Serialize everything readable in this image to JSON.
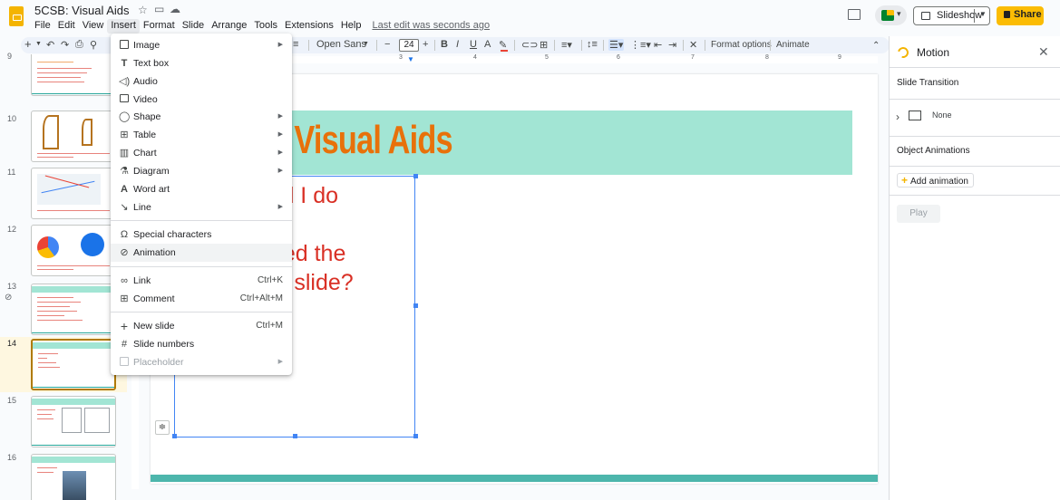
{
  "header": {
    "doc_title": "5CSB: Visual Aids",
    "menus": [
      "File",
      "Edit",
      "View",
      "Insert",
      "Format",
      "Slide",
      "Arrange",
      "Tools",
      "Extensions",
      "Help"
    ],
    "last_edit": "Last edit was seconds ago",
    "slideshow_label": "Slideshow",
    "share_label": "Share"
  },
  "toolbar": {
    "font_name": "Open Sans",
    "font_size": "24",
    "format_options": "Format options",
    "animate": "Animate",
    "ruler_marks": [
      "2",
      "3",
      "4",
      "5",
      "6",
      "7",
      "8",
      "9"
    ]
  },
  "insert_menu": {
    "items": [
      {
        "label": "Image",
        "icon": "image-icon",
        "submenu": true
      },
      {
        "label": "Text box",
        "icon": "text-box-icon"
      },
      {
        "label": "Audio",
        "icon": "audio-icon"
      },
      {
        "label": "Video",
        "icon": "video-icon"
      },
      {
        "label": "Shape",
        "icon": "shape-icon",
        "submenu": true
      },
      {
        "label": "Table",
        "icon": "table-icon",
        "submenu": true
      },
      {
        "label": "Chart",
        "icon": "chart-icon",
        "submenu": true
      },
      {
        "label": "Diagram",
        "icon": "diagram-icon",
        "submenu": true
      },
      {
        "label": "Word art",
        "icon": "word-art-icon"
      },
      {
        "label": "Line",
        "icon": "line-icon",
        "submenu": true
      },
      {
        "label": "Special characters",
        "icon": "omega-icon"
      },
      {
        "label": "Animation",
        "icon": "animation-icon"
      },
      {
        "label": "Link",
        "icon": "link-icon",
        "shortcut": "Ctrl+K"
      },
      {
        "label": "Comment",
        "icon": "comment-icon",
        "shortcut": "Ctrl+Alt+M"
      },
      {
        "label": "New slide",
        "icon": "plus-icon",
        "shortcut": "Ctrl+M"
      },
      {
        "label": "Slide numbers",
        "icon": "hash-icon"
      },
      {
        "label": "Placeholder",
        "icon": "placeholder-icon",
        "submenu": true,
        "disabled": true
      }
    ]
  },
  "filmstrip": {
    "slide_numbers": [
      "9",
      "10",
      "11",
      "12",
      "13",
      "14",
      "15",
      "16"
    ],
    "selected": "14"
  },
  "slide": {
    "title": "r Visual Aids",
    "body_lines": [
      "did I do",
      "",
      "nted the",
      "us slide?"
    ]
  },
  "motion_panel": {
    "title": "Motion",
    "slide_transition": "Slide Transition",
    "transition_value": "None",
    "object_animations": "Object Animations",
    "add_animation": "Add animation",
    "play": "Play"
  },
  "colors": {
    "accent_yellow": "#fbbc04",
    "title_orange": "#e8710a",
    "title_bar": "#a2e5d4",
    "body_red": "#d93025",
    "selection_blue": "#4285f4"
  }
}
